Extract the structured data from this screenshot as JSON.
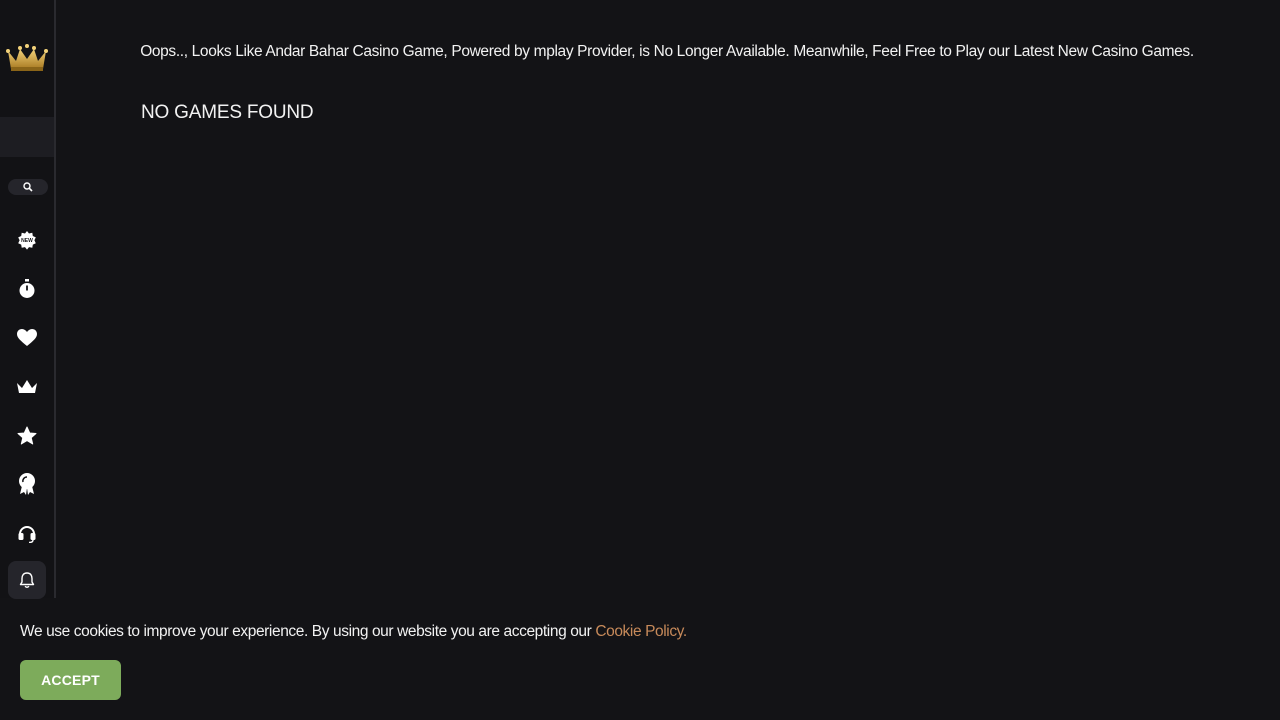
{
  "notice": {
    "text": "Oops.., Looks Like Andar Bahar Casino Game, Powered by mplay Provider, is No Longer Available. Meanwhile, Feel Free to Play our Latest New Casino Games."
  },
  "results": {
    "empty_label": "NO GAMES FOUND"
  },
  "sidebar": {
    "icons": [
      "crown-logo-icon",
      "search-icon",
      "new-badge-icon",
      "stopwatch-icon",
      "heart-icon",
      "crown-icon",
      "star-icon",
      "award-ribbon-icon",
      "headset-icon",
      "bell-icon"
    ]
  },
  "cookie": {
    "message": "We use cookies to improve your experience. By using our website you are accepting our ",
    "link_label": "Cookie Policy.",
    "accept_label": "ACCEPT"
  },
  "colors": {
    "background": "#131316",
    "accent_green": "#7dab5b",
    "link_orange": "#c78a5a",
    "logo_gold": "#d4a63a"
  }
}
